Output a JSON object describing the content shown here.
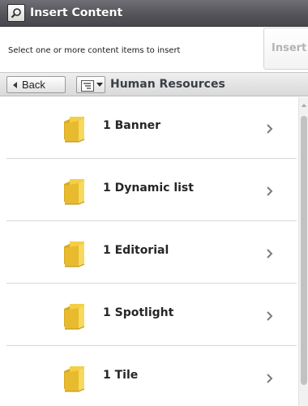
{
  "window": {
    "title": "Insert Content",
    "title_icon": "search-icon"
  },
  "subheader": {
    "instruction": "Select one or more content items to insert",
    "insert_label": "Insert"
  },
  "navbar": {
    "back_label": "Back",
    "view_icon": "list-view-icon",
    "breadcrumb": "Human Resources"
  },
  "items": [
    {
      "label": "1 Banner",
      "icon": "folder-icon"
    },
    {
      "label": "1 Dynamic list",
      "icon": "folder-icon"
    },
    {
      "label": "1 Editorial",
      "icon": "folder-icon"
    },
    {
      "label": "1 Spotlight",
      "icon": "folder-icon"
    },
    {
      "label": "1 Tile",
      "icon": "folder-icon"
    }
  ],
  "colors": {
    "titlebar": "#55555b",
    "navbar": "#e3e3e3",
    "folder": "#f2cb3c",
    "breadcrumb_text": "#3a3f47",
    "disabled_text": "#b4b4b4"
  }
}
